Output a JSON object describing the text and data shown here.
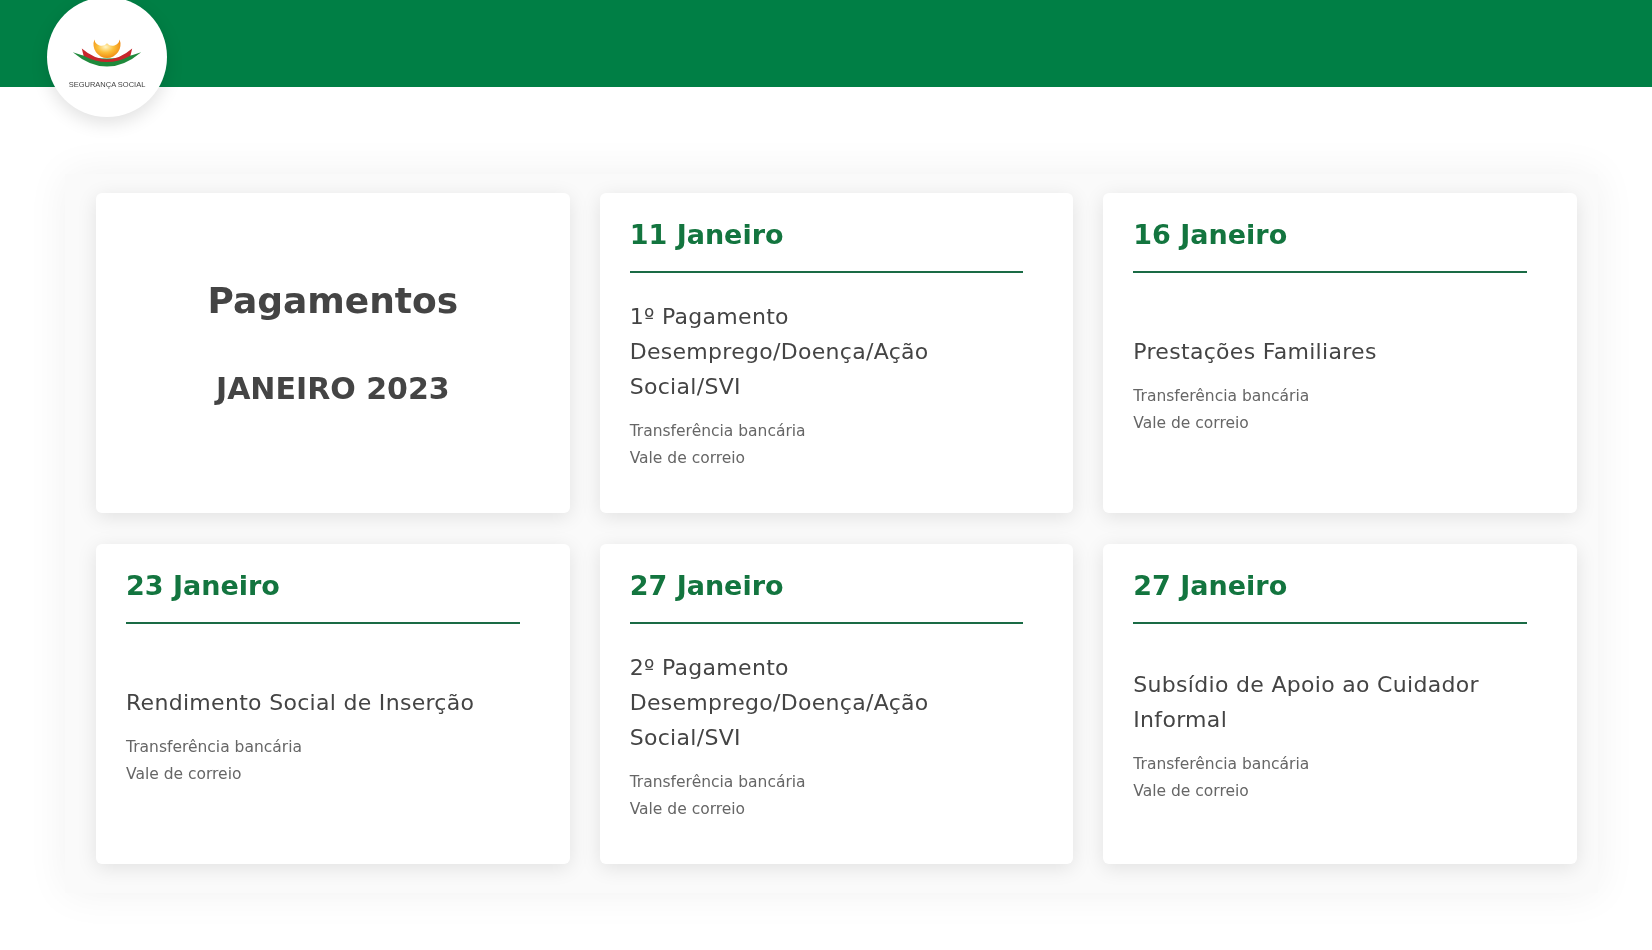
{
  "header": {
    "logo_text": "SEGURANÇA SOCIAL"
  },
  "cards": [
    {
      "kind": "title",
      "title": "Pagamentos",
      "subtitle": "JANEIRO 2023"
    },
    {
      "kind": "payment",
      "date": "11 Janeiro",
      "benefit": "1º Pagamento Desemprego/Doença/Ação Social/SVI",
      "methods": [
        "Transferência bancária",
        "Vale de correio"
      ]
    },
    {
      "kind": "payment",
      "date": "16 Janeiro",
      "benefit": "Prestações Familiares",
      "methods": [
        "Transferência bancária",
        "Vale de correio"
      ]
    },
    {
      "kind": "payment",
      "date": "23 Janeiro",
      "benefit": "Rendimento Social de Inserção",
      "methods": [
        "Transferência bancária",
        "Vale de correio"
      ]
    },
    {
      "kind": "payment",
      "date": "27 Janeiro",
      "benefit": "2º Pagamento Desemprego/Doença/Ação Social/SVI",
      "methods": [
        "Transferência bancária",
        "Vale de correio"
      ]
    },
    {
      "kind": "payment",
      "date": "27 Janeiro",
      "benefit": "Subsídio de Apoio ao Cuidador Informal",
      "methods": [
        "Transferência bancária",
        "Vale de correio"
      ]
    }
  ]
}
